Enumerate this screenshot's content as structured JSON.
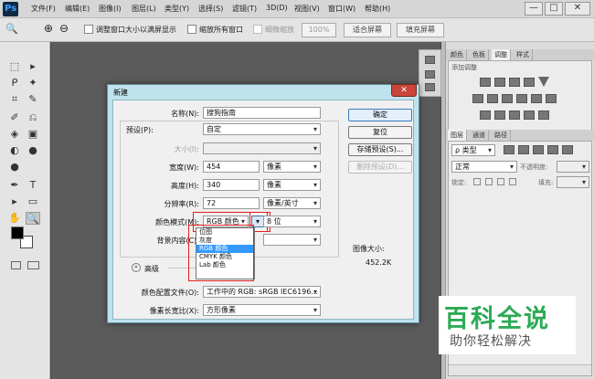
{
  "app": {
    "logo": "Ps"
  },
  "menu": [
    "文件(F)",
    "编辑(E)",
    "图像(I)",
    "图层(L)",
    "类型(Y)",
    "选择(S)",
    "滤镜(T)",
    "3D(D)",
    "视图(V)",
    "窗口(W)",
    "帮助(H)"
  ],
  "window_controls": {
    "minimize": "—",
    "restore": "□",
    "close": "✕"
  },
  "options": {
    "zoom_icon_glyph": "🔍",
    "zoom_in_glyph": "⊕",
    "zoom_out_glyph": "⊖",
    "resize_windows_label": "调整窗口大小以满屏显示",
    "zoom_all_label": "缩放所有窗口",
    "scrubby_label": "细微缩放",
    "zoom_pct": "100%",
    "fit_screen": "适合屏幕",
    "fill_screen": "填充屏幕"
  },
  "tools": [
    "⬚",
    "▸",
    "ᑭ",
    "✦",
    "⌗",
    "✎",
    "✐",
    "⎌",
    "◈",
    "▣",
    "◐",
    "●",
    "✒",
    "T",
    "▸",
    "▭",
    "✋",
    "🔍"
  ],
  "right_panel": {
    "tabs_top": [
      "颜色",
      "色板",
      "调整",
      "样式"
    ],
    "adjust_title": "添加调整",
    "tabs_layers": [
      "图层",
      "通道",
      "路径"
    ],
    "kind_label": "ρ 类型",
    "blend_mode": "正常",
    "opacity_label": "不透明度:",
    "lock_label": "锁定:",
    "fill_label": "填充:"
  },
  "dialog": {
    "title": "新建",
    "name_label": "名称(N):",
    "name_value": "搜狗指南",
    "preset_label": "预设(P):",
    "preset_value": "自定",
    "size_label": "大小(I):",
    "width_label": "宽度(W):",
    "width_value": "454",
    "width_unit": "像素",
    "height_label": "高度(H):",
    "height_value": "340",
    "height_unit": "像素",
    "resolution_label": "分辨率(R):",
    "resolution_value": "72",
    "resolution_unit": "像素/英寸",
    "color_mode_label": "颜色模式(M):",
    "color_mode_value": "RGB 颜色",
    "bit_depth_value": "8 位",
    "background_label": "背景内容(C):",
    "advanced_label": "高级",
    "profile_label": "颜色配置文件(O):",
    "profile_value": "工作中的 RGB: sRGB IEC6196...",
    "aspect_label": "像素长宽比(X):",
    "aspect_value": "方形像素",
    "ok": "确定",
    "reset": "复位",
    "save_preset": "存储预设(S)...",
    "delete_preset": "删除预设(D)...",
    "image_size_label": "图像大小:",
    "image_size_value": "452.2K",
    "dropdown": [
      "位图",
      "灰度",
      "RGB 颜色",
      "CMYK 颜色",
      "Lab 颜色"
    ],
    "dropdown_selected": 2
  },
  "watermark": {
    "line1": "百科全说",
    "line2": "助你轻松解决"
  }
}
